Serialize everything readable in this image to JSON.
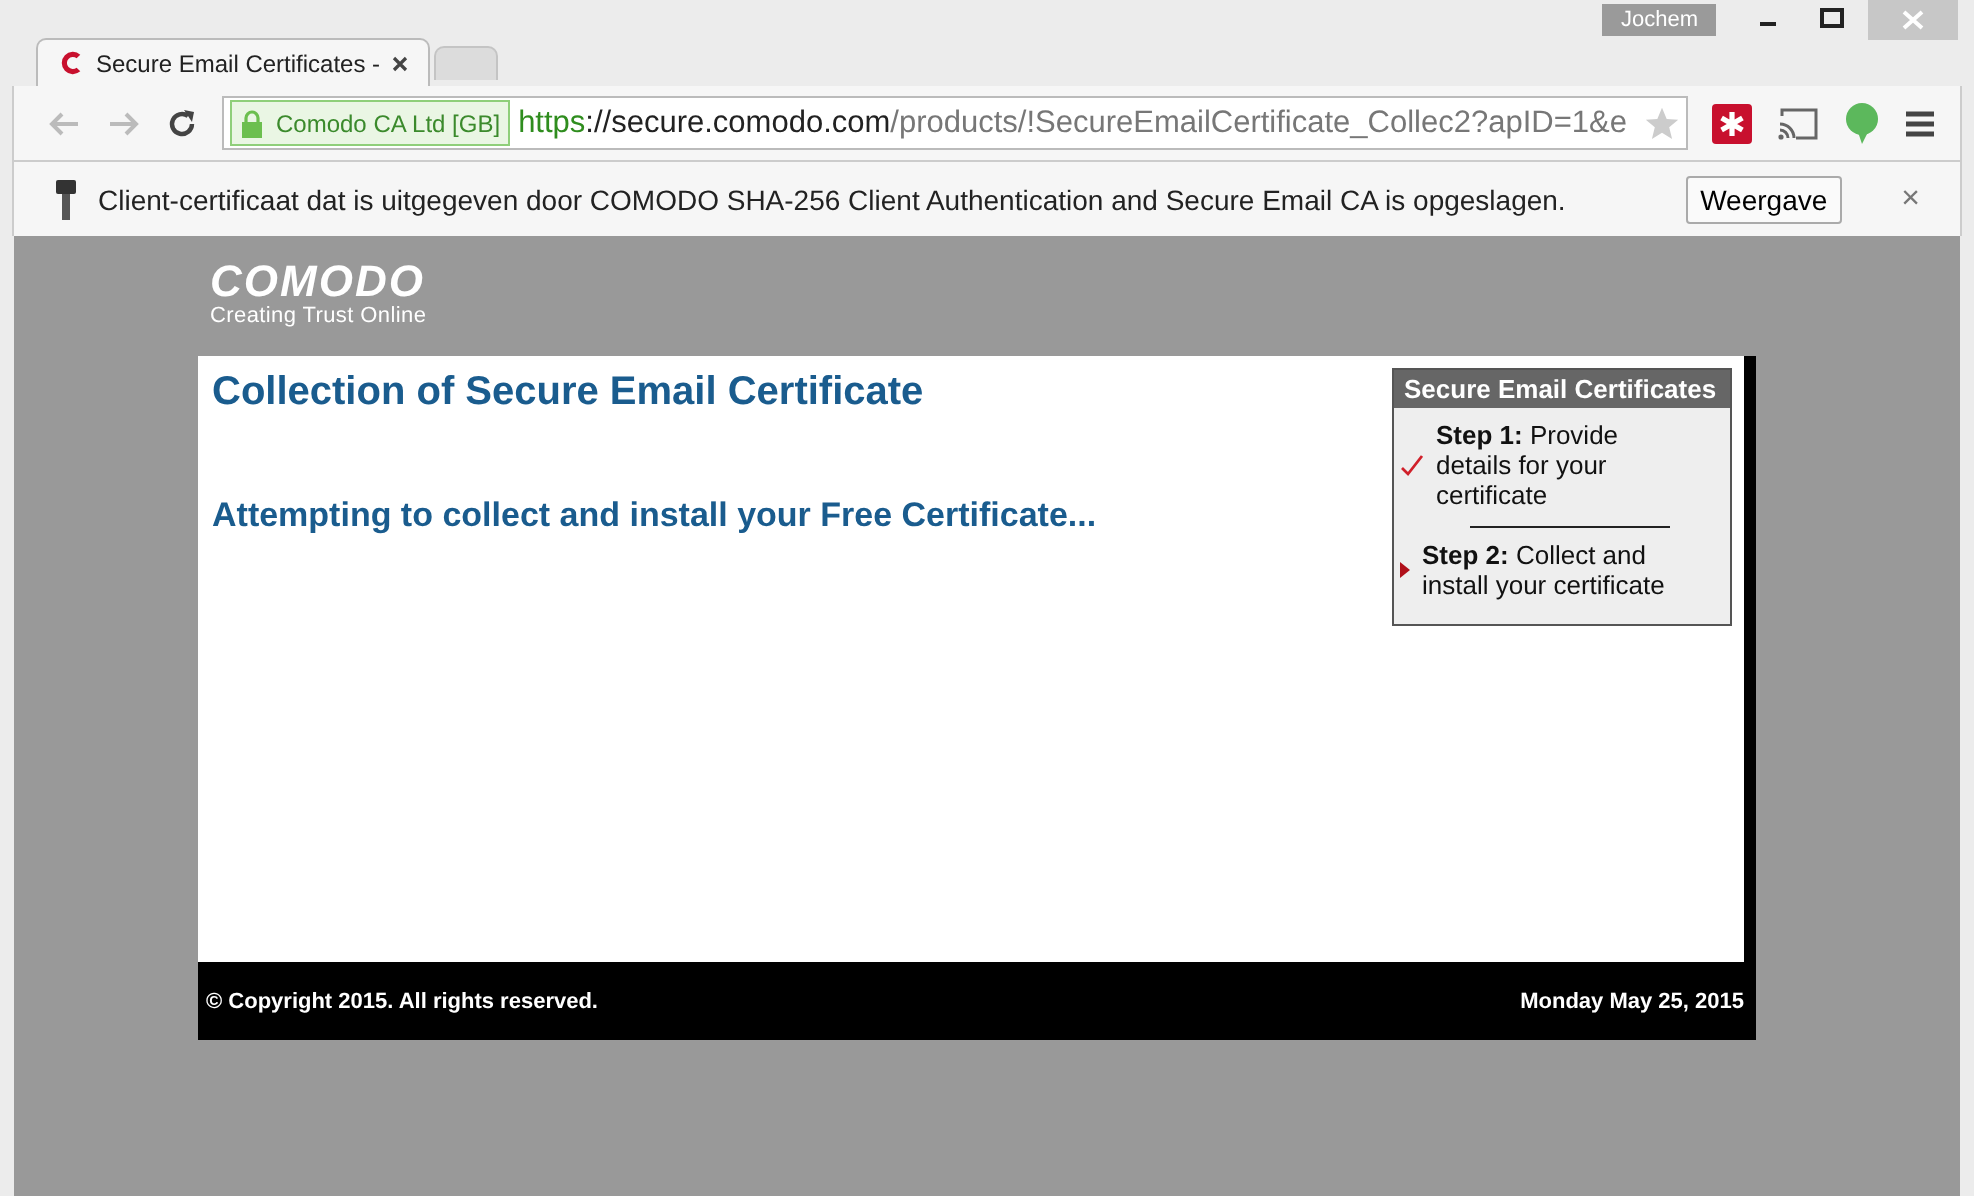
{
  "window": {
    "user": "Jochem"
  },
  "tabs": [
    {
      "title": "Secure Email Certificates -",
      "selected": true
    },
    {
      "selected": false
    }
  ],
  "toolbar": {
    "identity": "Comodo CA Ltd [GB]",
    "url_scheme": "https",
    "url_host": "://secure.comodo.com",
    "url_path": "/products/!SecureEmailCertificate_Collec2?apID=1&e"
  },
  "infobar": {
    "message": "Client-certificaat dat is uitgegeven door COMODO SHA-256 Client Authentication and Secure Email CA is opgeslagen.",
    "button": "Weergave",
    "close": "×"
  },
  "page": {
    "logo": "COMODO",
    "tagline": "Creating Trust Online",
    "heading": "Collection of Secure Email Certificate",
    "status": "Attempting to collect and install your Free Certificate...",
    "steps_title": "Secure Email Certificates",
    "steps": [
      {
        "kind": "done",
        "label": "Step 1:",
        "text": "Provide details for your certificate"
      },
      {
        "kind": "current",
        "label": "Step 2:",
        "text": "Collect and install your certificate"
      }
    ],
    "copyright": "© Copyright 2015. All rights reserved.",
    "date": "Monday May 25, 2015"
  }
}
